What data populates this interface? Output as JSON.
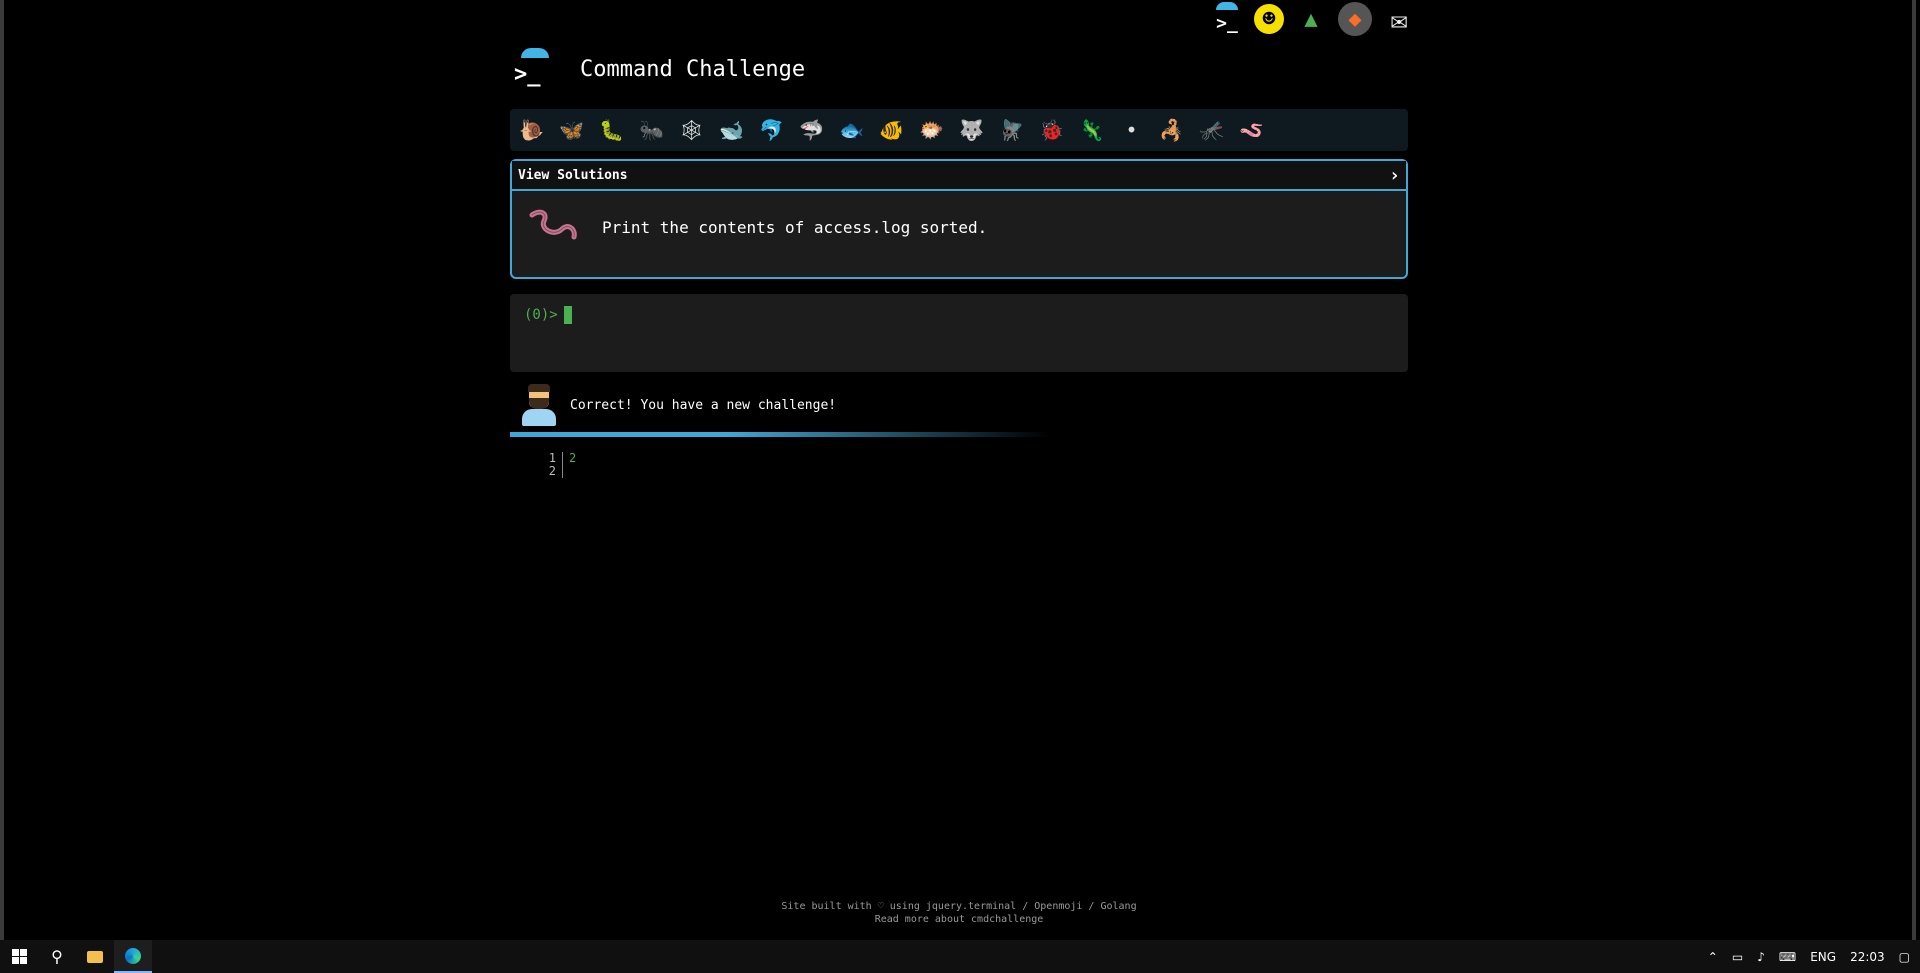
{
  "header": {
    "title": "Command Challenge"
  },
  "top_icons": [
    {
      "name": "terminal-link-icon",
      "glyph": ">_"
    },
    {
      "name": "smiley-face-icon",
      "glyph": "☺"
    },
    {
      "name": "tree-icon",
      "glyph": "▲"
    },
    {
      "name": "gitlab-icon",
      "glyph": "◆"
    },
    {
      "name": "mail-icon",
      "glyph": "✉"
    }
  ],
  "challenge_icons": [
    {
      "name": "snail-icon",
      "glyph": "🐌"
    },
    {
      "name": "butterfly-icon",
      "glyph": "🦋"
    },
    {
      "name": "caterpillar-icon",
      "glyph": "🐛"
    },
    {
      "name": "ant-icon",
      "glyph": "🐜"
    },
    {
      "name": "web-icon",
      "glyph": "🕸"
    },
    {
      "name": "whale-icon",
      "glyph": "🐋"
    },
    {
      "name": "dolphin-icon",
      "glyph": "🐬"
    },
    {
      "name": "shark-icon",
      "glyph": "🦈"
    },
    {
      "name": "fish-icon",
      "glyph": "🐟"
    },
    {
      "name": "tropical-fish-icon",
      "glyph": "🐠"
    },
    {
      "name": "pufferfish-icon",
      "glyph": "🐡"
    },
    {
      "name": "wolf-icon",
      "glyph": "🐺"
    },
    {
      "name": "fly-icon",
      "glyph": "🪰"
    },
    {
      "name": "ladybug-icon",
      "glyph": "🐞"
    },
    {
      "name": "lizard-icon",
      "glyph": "🦎"
    },
    {
      "name": "bug-icon",
      "glyph": "•"
    },
    {
      "name": "centipede-icon",
      "glyph": "🦂"
    },
    {
      "name": "moth-icon",
      "glyph": "🦟"
    },
    {
      "name": "worm-icon",
      "glyph": "🪱"
    }
  ],
  "solutions": {
    "label": "View Solutions",
    "chevron": "›",
    "task": "Print the contents of access.log sorted."
  },
  "terminal": {
    "prompt": "(0)>"
  },
  "feedback": {
    "message": "Correct! You have a new challenge!"
  },
  "output": [
    {
      "line": "1",
      "value": "2"
    },
    {
      "line": "2",
      "value": ""
    }
  ],
  "footer": {
    "line1": "Site built with ♡ using jquery.terminal / Openmoji / Golang",
    "line2": "Read more about cmdchallenge"
  },
  "taskbar": {
    "language": "ENG",
    "time": "22:03"
  },
  "colors": {
    "accent": "#41a8d6",
    "prompt_green": "#4caf50",
    "background": "#000000"
  }
}
